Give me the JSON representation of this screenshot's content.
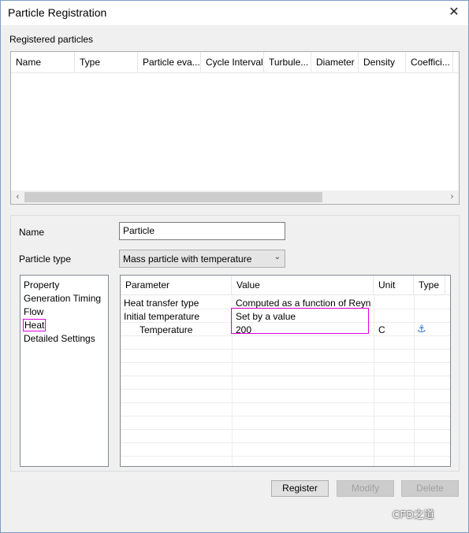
{
  "window": {
    "title": "Particle Registration",
    "close_symbol": "✕"
  },
  "registered": {
    "label": "Registered particles",
    "columns": [
      "Name",
      "Type",
      "Particle eva...",
      "Cycle Interval",
      "Turbule...",
      "Diameter",
      "Density",
      "Coeffici..."
    ],
    "scroll_left": "‹",
    "scroll_right": "›"
  },
  "form": {
    "name_label": "Name",
    "name_value": "Particle",
    "type_label": "Particle type",
    "type_value": "Mass particle with temperature"
  },
  "nav": {
    "items": [
      "Property",
      "Generation Timing",
      "Flow",
      "Heat",
      "Detailed Settings"
    ],
    "selected": "Heat"
  },
  "grid": {
    "headers": [
      "Parameter",
      "Value",
      "Unit",
      "Type"
    ],
    "rows": [
      {
        "parameter": "Heat transfer type",
        "value": "Computed as a function of Reyn...",
        "unit": "",
        "type": ""
      },
      {
        "parameter": "Initial temperature",
        "value": "Set by a value",
        "unit": "",
        "type": ""
      },
      {
        "parameter": "Temperature",
        "value": "200",
        "unit": "C",
        "type": "anchor-icon"
      }
    ]
  },
  "buttons": {
    "register": "Register",
    "modify": "Modify",
    "delete": "Delete"
  },
  "watermark": "CFD之道",
  "colors": {
    "highlight": "#e000e0",
    "accent": "#0078d7"
  }
}
